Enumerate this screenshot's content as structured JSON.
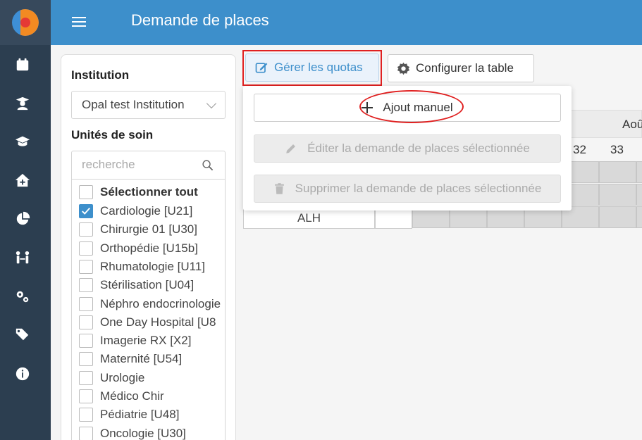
{
  "app": {
    "title": "Demande de places"
  },
  "sidebar": {
    "icons": [
      "calendar-icon",
      "graduate-icon",
      "graduation-cap-icon",
      "home-plus-icon",
      "pie-chart-icon",
      "people-exchange-icon",
      "gears-icon",
      "tags-icon",
      "info-icon"
    ]
  },
  "filters": {
    "institution_label": "Institution",
    "institution_value": "Opal test Institution",
    "units_label": "Unités de soin",
    "search_placeholder": "recherche",
    "select_all": "Sélectionner tout",
    "units": [
      {
        "label": "Cardiologie [U21]",
        "checked": true
      },
      {
        "label": "Chirurgie 01 [U30]",
        "checked": false
      },
      {
        "label": "Orthopédie [U15b]",
        "checked": false
      },
      {
        "label": "Rhumatologie [U11]",
        "checked": false
      },
      {
        "label": "Stérilisation [U04]",
        "checked": false
      },
      {
        "label": "Néphro endocrinologie",
        "checked": false
      },
      {
        "label": "One Day Hospital [U8",
        "checked": false
      },
      {
        "label": "Imagerie RX [X2]",
        "checked": false
      },
      {
        "label": "Maternité [U54]",
        "checked": false
      },
      {
        "label": "Urologie",
        "checked": false
      },
      {
        "label": "Médico Chir",
        "checked": false
      },
      {
        "label": "Pédiatrie [U48]",
        "checked": false
      },
      {
        "label": "Oncologie [U30]",
        "checked": false
      }
    ]
  },
  "toolbar": {
    "quota_label": "Gérer les quotas",
    "config_label": "Configurer la table"
  },
  "dropdown": {
    "add_manual": "Ajout manuel",
    "edit_selected": "Éditer la demande de places sélectionnée",
    "delete_selected": "Supprimer la demande de places sélectionnée"
  },
  "table": {
    "month_header": "Aoû",
    "week_numbers": [
      "32",
      "33"
    ],
    "row_label": "ALH"
  },
  "colors": {
    "sidebar_bg": "#2c3e50",
    "topbar_bg": "#3d8fcb",
    "accent": "#3d8fcb",
    "highlight": "#e02020"
  }
}
